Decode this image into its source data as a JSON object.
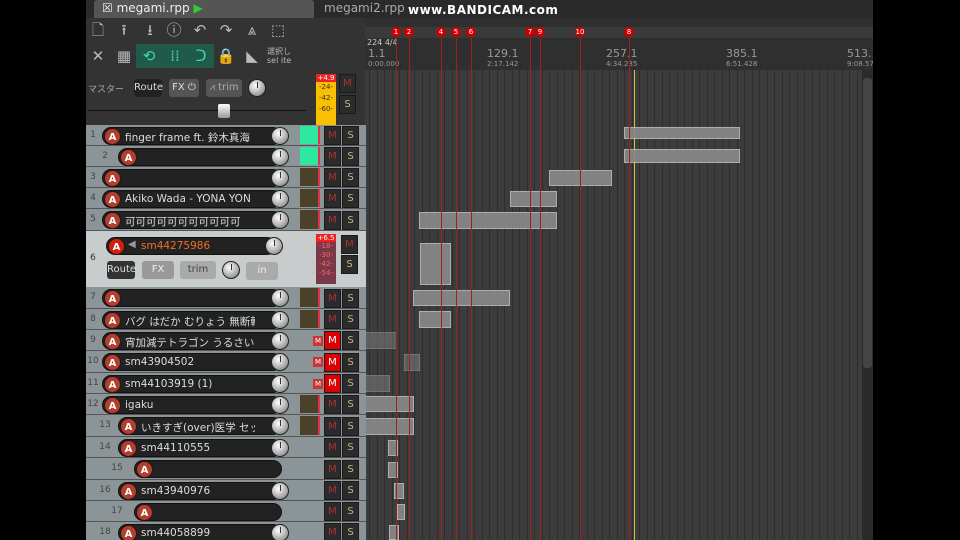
{
  "tabs": [
    "megami.rpp",
    "megami2.rpp"
  ],
  "watermark": "www.BANDICAM.com",
  "toolbar": {
    "select_label_jp": "選択し",
    "select_label_en": "sel ite"
  },
  "master": {
    "label": "マスター",
    "route": "Route",
    "fx": "FX",
    "trim": "trim",
    "peak": "+4.9",
    "meter_ticks": [
      "-24-",
      "-42-",
      "-60-"
    ],
    "mute": "M",
    "solo": "S"
  },
  "ruler": {
    "time_sig": "224 4/4",
    "marks": [
      {
        "bar": "1.1",
        "time": "0:00.000"
      },
      {
        "bar": "129.1",
        "time": "2:17.142"
      },
      {
        "bar": "257.1",
        "time": "4:34.285"
      },
      {
        "bar": "385.1",
        "time": "6:51.428"
      },
      {
        "bar": "513.1",
        "time": "9:08.57"
      }
    ]
  },
  "markers": [
    "1",
    "2",
    "4",
    "5",
    "6",
    "7",
    "9",
    "10",
    "8"
  ],
  "selected_track": {
    "number": "6",
    "name": "sm44275986",
    "route": "Route",
    "fx": "FX",
    "trim": "trim",
    "input": "in",
    "peak": "+6.5",
    "meter_ticks": [
      "-18-",
      "-30-",
      "-42-",
      "-54-"
    ]
  },
  "tracks": [
    {
      "number": "1",
      "name": "finger frame ft. 鈴木真海",
      "folder": true
    },
    {
      "number": "2",
      "name": ""
    },
    {
      "number": "3",
      "name": ""
    },
    {
      "number": "4",
      "name": "Akiko Wada - YONA YON"
    },
    {
      "number": "5",
      "name": "可可可可可可可可可可可"
    },
    {
      "number": "7",
      "name": ""
    },
    {
      "number": "8",
      "name": "バグ はだか むりょう 無断転"
    },
    {
      "number": "9",
      "name": "宵加減テトラゴン うるさいコ",
      "muted": true
    },
    {
      "number": "10",
      "name": "sm43904502",
      "muted": true
    },
    {
      "number": "11",
      "name": "sm44103919 (1)",
      "muted": true
    },
    {
      "number": "12",
      "name": "igaku",
      "folder": true
    },
    {
      "number": "13",
      "name": "いきすぎ(over)医学 セックス"
    },
    {
      "number": "14",
      "name": "sm44110555",
      "folder": true
    },
    {
      "number": "15",
      "name": ""
    },
    {
      "number": "16",
      "name": "sm43940976",
      "folder": true
    },
    {
      "number": "17",
      "name": ""
    },
    {
      "number": "18",
      "name": "sm44058899",
      "folder": true
    }
  ],
  "labels": {
    "mute": "M",
    "solo": "S",
    "rec": "A",
    "muted_badge": "M"
  }
}
